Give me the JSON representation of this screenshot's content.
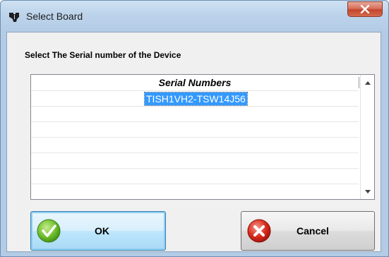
{
  "window": {
    "title": "Select Board",
    "close_icon": "close-icon",
    "app_icon": "ti-logo-icon"
  },
  "dialog": {
    "prompt": "Select The Serial number of the Device"
  },
  "grid": {
    "column_header": "Serial Numbers",
    "rows": [
      "TISH1VH2-TSW14J56",
      "",
      "",
      "",
      "",
      "",
      ""
    ],
    "selected_row": 0
  },
  "buttons": {
    "ok_label": "OK",
    "ok_icon": "check-icon",
    "cancel_label": "Cancel",
    "cancel_icon": "x-circle-icon"
  },
  "colors": {
    "selection": "#3399ff",
    "ok_icon": "#6dbf2b",
    "cancel_icon": "#d8291c"
  }
}
